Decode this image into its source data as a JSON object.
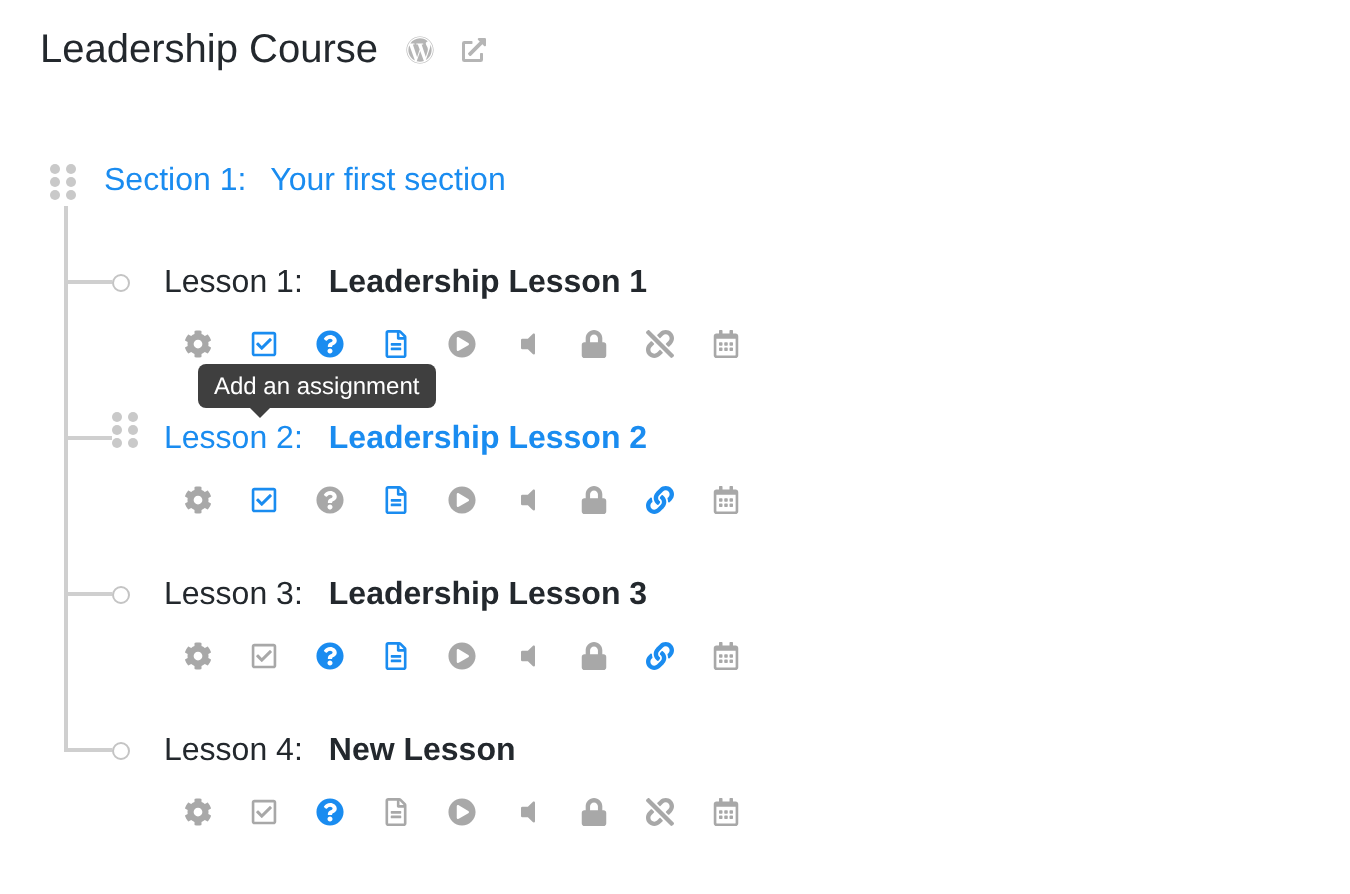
{
  "course": {
    "title": "Leadership Course"
  },
  "section": {
    "label": "Section 1:",
    "title": "Your first section"
  },
  "lessons": [
    {
      "label": "Lesson 1:",
      "title": "Leadership Lesson 1",
      "hovered": false,
      "icons": [
        {
          "kind": "settings",
          "active": false
        },
        {
          "kind": "assignment",
          "active": true
        },
        {
          "kind": "quiz",
          "active": true
        },
        {
          "kind": "document",
          "active": true
        },
        {
          "kind": "video",
          "active": false
        },
        {
          "kind": "audio",
          "active": false
        },
        {
          "kind": "lock",
          "active": false
        },
        {
          "kind": "link",
          "active": false
        },
        {
          "kind": "calendar",
          "active": false
        }
      ]
    },
    {
      "label": "Lesson 2:",
      "title": "Leadership Lesson 2",
      "hovered": true,
      "icons": [
        {
          "kind": "settings",
          "active": false
        },
        {
          "kind": "assignment",
          "active": true,
          "tooltip": "Add an assignment"
        },
        {
          "kind": "quiz",
          "active": false
        },
        {
          "kind": "document",
          "active": true
        },
        {
          "kind": "video",
          "active": false
        },
        {
          "kind": "audio",
          "active": false
        },
        {
          "kind": "lock",
          "active": false
        },
        {
          "kind": "link",
          "active": true
        },
        {
          "kind": "calendar",
          "active": false
        }
      ]
    },
    {
      "label": "Lesson 3:",
      "title": "Leadership Lesson 3",
      "hovered": false,
      "icons": [
        {
          "kind": "settings",
          "active": false
        },
        {
          "kind": "assignment",
          "active": false
        },
        {
          "kind": "quiz",
          "active": true
        },
        {
          "kind": "document",
          "active": true
        },
        {
          "kind": "video",
          "active": false
        },
        {
          "kind": "audio",
          "active": false
        },
        {
          "kind": "lock",
          "active": false
        },
        {
          "kind": "link",
          "active": true
        },
        {
          "kind": "calendar",
          "active": false
        }
      ]
    },
    {
      "label": "Lesson 4:",
      "title": "New Lesson",
      "hovered": false,
      "icons": [
        {
          "kind": "settings",
          "active": false
        },
        {
          "kind": "assignment",
          "active": false
        },
        {
          "kind": "quiz",
          "active": true
        },
        {
          "kind": "document",
          "active": false
        },
        {
          "kind": "video",
          "active": false
        },
        {
          "kind": "audio",
          "active": false
        },
        {
          "kind": "lock",
          "active": false
        },
        {
          "kind": "link",
          "active": false
        },
        {
          "kind": "calendar",
          "active": false
        }
      ]
    }
  ]
}
